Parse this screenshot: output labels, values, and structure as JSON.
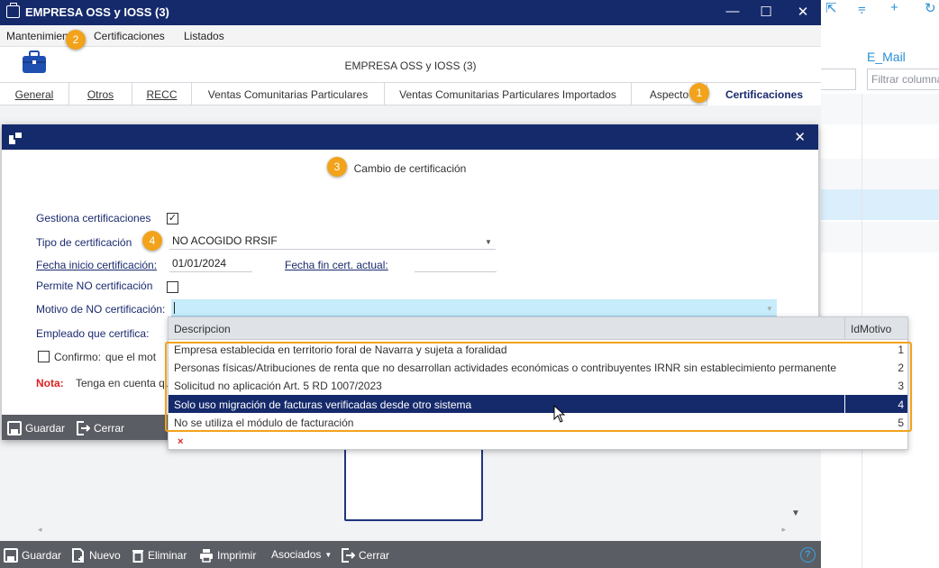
{
  "window": {
    "title": "EMPRESA OSS y IOSS (3)",
    "heading": "EMPRESA OSS y IOSS (3)",
    "minimize": "—",
    "maximize": "☐",
    "close": "✕"
  },
  "menu": {
    "items": [
      "Mantenimiento",
      "Certificaciones",
      "Listados"
    ]
  },
  "tabs": [
    "General",
    "Otros",
    "RECC",
    "Ventas Comunitarias Particulares",
    "Ventas Comunitarias Particulares Importados",
    "Aspecto",
    "Certificaciones"
  ],
  "background_grid": {
    "column_header": "E_Mail",
    "filter_placeholder": "Filtrar columna"
  },
  "dialog": {
    "heading": "Cambio de certificación",
    "close": "✕",
    "fields": {
      "gestiona_label": "Gestiona certificaciones",
      "gestiona_checked": "✓",
      "tipo_label": "Tipo de certificación",
      "tipo_value": "NO ACOGIDO RRSIF",
      "fecha_inicio_label": "Fecha inicio certificación:",
      "fecha_inicio_value": "01/01/2024",
      "fecha_fin_label": "Fecha fin cert. actual:",
      "fecha_fin_value": "",
      "permite_label": "Permite NO certificación",
      "motivo_label": "Motivo de NO certificación:",
      "empleado_label": "Empleado que certifica:",
      "confirmo_label": "Confirmo:",
      "confirmo_text": "que el mot",
      "nota_label": "Nota:",
      "nota_text": "Tenga en cuenta qu"
    },
    "footer": {
      "save": "Guardar",
      "close": "Cerrar"
    }
  },
  "dropdown": {
    "headers": {
      "descripcion": "Descripcion",
      "id": "IdMotivo"
    },
    "rows": [
      {
        "desc": "Empresa establecida en territorio foral de Navarra y sujeta a foralidad",
        "id": "1"
      },
      {
        "desc": "Personas físicas/Atribuciones de renta que no desarrollan actividades económicas o contribuyentes IRNR sin establecimiento permanente",
        "id": "2"
      },
      {
        "desc": "Solicitud no aplicación Art. 5 RD 1007/2023",
        "id": "3"
      },
      {
        "desc": "Solo uso migración de facturas verificadas desde otro sistema",
        "id": "4"
      },
      {
        "desc": "No se utiliza el módulo de facturación",
        "id": "5"
      }
    ],
    "selected_id": "4",
    "clear_icon": "×"
  },
  "bottom_toolbar": {
    "save": "Guardar",
    "new": "Nuevo",
    "delete": "Eliminar",
    "print": "Imprimir",
    "associated": "Asociados",
    "close": "Cerrar",
    "help": "?"
  },
  "callouts": [
    "1",
    "2",
    "3",
    "4"
  ],
  "colors": {
    "titlebar": "#152a6b",
    "accent": "#f2a31b",
    "selected_row": "#152a6b",
    "motivo_input": "#c7ecfb",
    "toolbar": "#5a5d63"
  }
}
